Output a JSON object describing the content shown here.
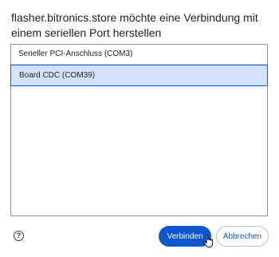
{
  "dialog": {
    "title": "flasher.bitronics.store möchte eine Verbindung mit einem seriellen Port herstellen"
  },
  "ports": {
    "items": [
      {
        "label": "Serieller PCI-Anschluss (COM3)",
        "selected": false
      },
      {
        "label": "Board CDC (COM39)",
        "selected": true
      }
    ]
  },
  "footer": {
    "help_icon": "help-circle-icon",
    "help_glyph": "?",
    "connect_label": "Verbinden",
    "cancel_label": "Abbrechen"
  },
  "colors": {
    "accent": "#0b57d0",
    "selection_bg": "#d3e3fd"
  }
}
